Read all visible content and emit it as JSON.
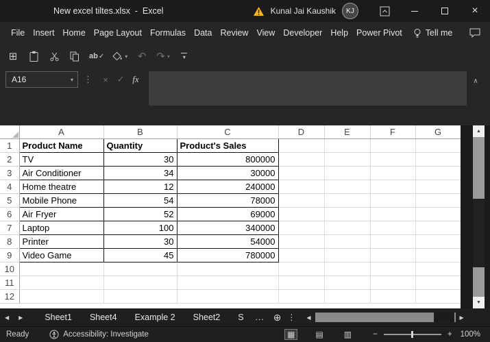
{
  "titlebar": {
    "title": "New excel tiltes.xlsx  -  Excel",
    "user_name": "Kunal Jai Kaushik",
    "avatar_initials": "KJ"
  },
  "menubar": {
    "items": [
      "File",
      "Insert",
      "Home",
      "Page Layout",
      "Formulas",
      "Data",
      "Review",
      "View",
      "Developer",
      "Help",
      "Power Pivot"
    ],
    "tell_me_label": "Tell me"
  },
  "formula_bar": {
    "name_box_value": "A16",
    "formula_value": ""
  },
  "grid": {
    "column_headers": [
      "A",
      "B",
      "C",
      "D",
      "E",
      "F",
      "G"
    ],
    "row_numbers": [
      "1",
      "2",
      "3",
      "4",
      "5",
      "6",
      "7",
      "8",
      "9",
      "10",
      "11",
      "12"
    ],
    "cells": [
      [
        "Product Name",
        "Quantity",
        "Product's Sales"
      ],
      [
        "TV",
        "30",
        "800000"
      ],
      [
        "Air Conditioner",
        "34",
        "30000"
      ],
      [
        "Home theatre",
        "12",
        "240000"
      ],
      [
        "Mobile Phone",
        "54",
        "78000"
      ],
      [
        "Air Fryer",
        "52",
        "69000"
      ],
      [
        "Laptop",
        "100",
        "340000"
      ],
      [
        "Printer",
        "30",
        "54000"
      ],
      [
        "Video Game",
        "45",
        "780000"
      ]
    ]
  },
  "sheet_tabs": {
    "tabs": [
      "Sheet1",
      "Sheet4",
      "Example 2",
      "Sheet2",
      "S"
    ],
    "overflow_indicator": "..."
  },
  "status_bar": {
    "ready_label": "Ready",
    "accessibility_label": "Accessibility: Investigate",
    "zoom_level": "100%"
  },
  "icons": {
    "table_glyph": "⊞",
    "spell_ab": "ab",
    "check_glyph": "✓",
    "undo_glyph": "↶",
    "redo_glyph": "↷",
    "caret_down": "▾",
    "dots_vertical": "⋮",
    "cancel_glyph": "×",
    "close_glyph": "×",
    "fx_label": "fx",
    "collapse_chevron": "∧",
    "add_sheet_glyph": "⊕",
    "nav_left": "◀",
    "nav_right": "▶",
    "scroll_up": "▲",
    "scroll_down": "▼",
    "view_normal_glyph": "▦",
    "view_layout_glyph": "▤",
    "view_break_glyph": "▥",
    "zoom_minus": "−",
    "zoom_plus": "+"
  },
  "colors": {
    "chrome_bg": "#262626",
    "titlebar_bg": "#1b1b1b",
    "grid_bg": "#ffffff",
    "warning_yellow": "#fdb913",
    "table_border": "#141414"
  }
}
